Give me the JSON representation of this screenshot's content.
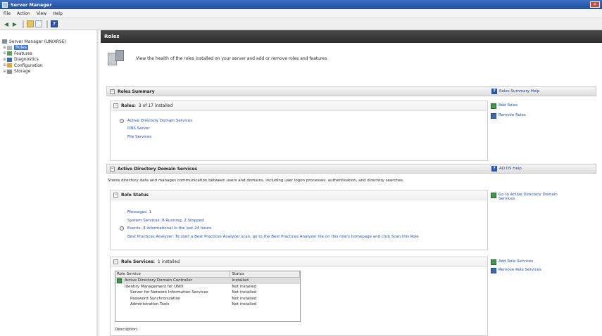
{
  "window": {
    "title": "Server Manager"
  },
  "menu": [
    "File",
    "Action",
    "View",
    "Help"
  ],
  "toolbar": {
    "icons": [
      "back-icon",
      "forward-icon",
      "folder-icon",
      "grid-icon",
      "help-icon"
    ]
  },
  "tree": {
    "items": [
      {
        "label": "Server Manager (UNIXRSE)",
        "indent": 0,
        "expander": "",
        "icon": "server-icon"
      },
      {
        "label": "Roles",
        "indent": 1,
        "expander": "⊞",
        "icon": "roles-icon",
        "selected": true
      },
      {
        "label": "Features",
        "indent": 1,
        "expander": "⊞",
        "icon": "features-icon"
      },
      {
        "label": "Diagnostics",
        "indent": 1,
        "expander": "⊞",
        "icon": "diagnostics-icon"
      },
      {
        "label": "Configuration",
        "indent": 1,
        "expander": "⊞",
        "icon": "configuration-icon"
      },
      {
        "label": "Storage",
        "indent": 1,
        "expander": "⊞",
        "icon": "storage-icon"
      }
    ]
  },
  "main": {
    "header": "Roles",
    "intro": "View the health of the roles installed on your server and add or remove roles and features.",
    "roles_summary": {
      "title": "Roles Summary",
      "help": "Roles Summary Help",
      "roles_label": "Roles:",
      "roles_count": "3 of 17 installed",
      "roles": [
        "Active Directory Domain Services",
        "DNS Server",
        "File Services"
      ],
      "actions": [
        "Add Roles",
        "Remove Roles"
      ]
    },
    "adds": {
      "title": "Active Directory Domain Services",
      "help": "AD DS Help",
      "description": "Stores directory data and manages communication between users and domains, including user logon processes, authentication, and directory searches.",
      "role_status": {
        "title": "Role Status",
        "action": "Go to Active Directory Domain Services",
        "messages": "Messages: 1",
        "system_services": "System Services: 8 Running, 2 Stopped",
        "events": "Events: 4 informational in the last 24 hours",
        "bpa": "Best Practices Analyzer: To start a Best Practices Analyzer scan, go to the Best Practices Analyzer tile on this role's homepage and click Scan this Role"
      },
      "role_services": {
        "title": "Role Services:",
        "count": "1 installed",
        "actions": [
          "Add Role Services",
          "Remove Role Services"
        ],
        "columns": [
          "Role Service",
          "Status"
        ],
        "rows": [
          {
            "service": "Active Directory Domain Controller",
            "status": "Installed",
            "level": 0,
            "selected": true
          },
          {
            "service": "Identity Management for UNIX",
            "status": "Not installed",
            "level": 0
          },
          {
            "service": "Server for Network Information Services",
            "status": "Not installed",
            "level": 1
          },
          {
            "service": "Password Synchronization",
            "status": "Not installed",
            "level": 1
          },
          {
            "service": "Administration Tools",
            "status": "Not installed",
            "level": 1
          }
        ],
        "description_label": "Description:"
      }
    }
  }
}
